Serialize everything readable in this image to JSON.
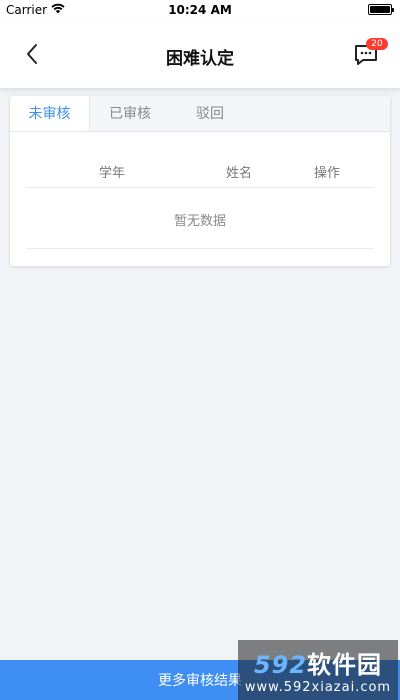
{
  "status_bar": {
    "carrier": "Carrier",
    "time": "10:24 AM"
  },
  "nav": {
    "title": "困难认定",
    "badge_count": "20",
    "icons": {
      "back": "chevron-left-icon",
      "messages": "chat-icon"
    }
  },
  "tabs": [
    {
      "label": "未审核",
      "active": true
    },
    {
      "label": "已审核",
      "active": false
    },
    {
      "label": "驳回",
      "active": false
    }
  ],
  "table": {
    "columns": [
      "学年",
      "姓名",
      "操作"
    ],
    "empty_text": "暂无数据"
  },
  "bottom": {
    "label": "更多审核结果"
  },
  "watermark": {
    "logo_num": "592",
    "logo_text": "软件园",
    "url": "www.592xiazai.com"
  },
  "colors": {
    "accent": "#3e8ef3",
    "badge": "#ff3b30",
    "background": "#f2f3f7"
  }
}
